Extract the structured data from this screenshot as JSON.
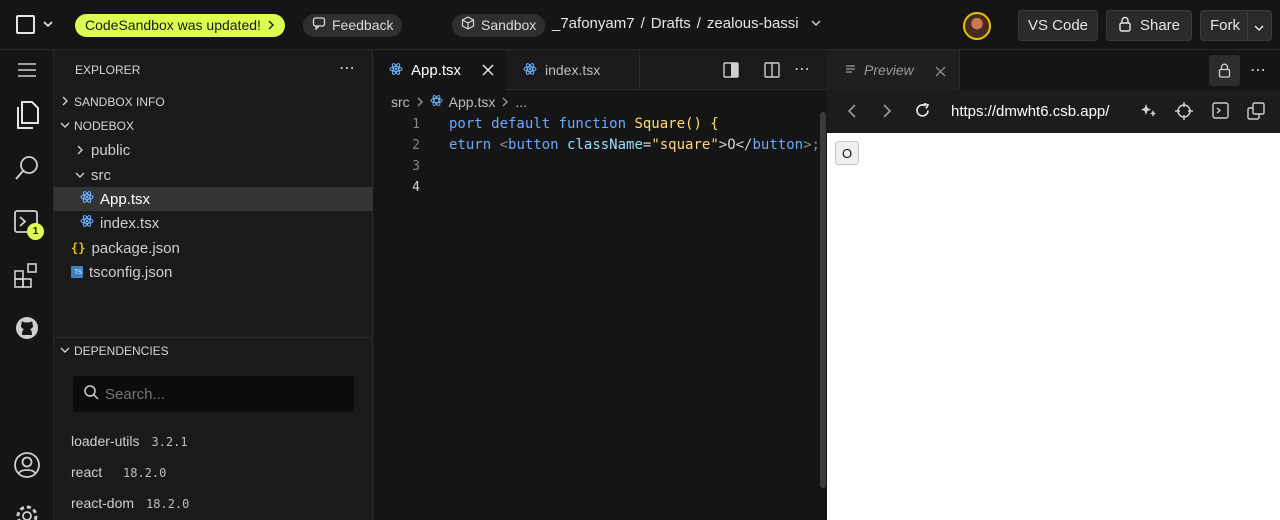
{
  "topbar": {
    "update_notice": "CodeSandbox was updated!",
    "feedback": "Feedback",
    "sandbox": "Sandbox",
    "path": [
      "_7afonyam7",
      "/",
      "Drafts",
      "/",
      "zealous-bassi"
    ],
    "vscode": "VS Code",
    "share": "Share",
    "fork": "Fork"
  },
  "activity": {
    "badge": "1"
  },
  "explorer": {
    "title": "EXPLORER",
    "sandbox_info": "SANDBOX INFO",
    "nodebox": "NODEBOX",
    "tree": [
      {
        "label": "public",
        "kind": "folder"
      },
      {
        "label": "src",
        "kind": "folder"
      },
      {
        "label": "App.tsx",
        "kind": "react"
      },
      {
        "label": "index.tsx",
        "kind": "react"
      },
      {
        "label": "package.json",
        "kind": "json"
      },
      {
        "label": "tsconfig.json",
        "kind": "ts"
      }
    ],
    "dependencies_title": "DEPENDENCIES",
    "search_placeholder": "Search...",
    "dependencies": [
      {
        "name": "loader-utils",
        "version": "3.2.1"
      },
      {
        "name": "react",
        "version": "18.2.0"
      },
      {
        "name": "react-dom",
        "version": "18.2.0"
      }
    ]
  },
  "editor": {
    "tabs": [
      {
        "label": "App.tsx",
        "active": true
      },
      {
        "label": "index.tsx",
        "active": false
      }
    ],
    "breadcrumb": [
      "src",
      "App.tsx",
      "..."
    ],
    "line_numbers": [
      "1",
      "2",
      "3",
      "4"
    ],
    "line1": {
      "a": "port default ",
      "b": "function ",
      "c": "Square",
      "d": "() {"
    },
    "line2": {
      "a": "eturn ",
      "b": "<",
      "c": "button ",
      "d": "className",
      "e": "=",
      "f": "\"square\"",
      "g": ">O</",
      "h": "button",
      "i": ">;"
    }
  },
  "preview": {
    "tab_label": "Preview",
    "url": "https://dmwht6.csb.app/",
    "button_label": "O"
  },
  "colors": {
    "accent": "#dcff50",
    "background": "#151515"
  }
}
